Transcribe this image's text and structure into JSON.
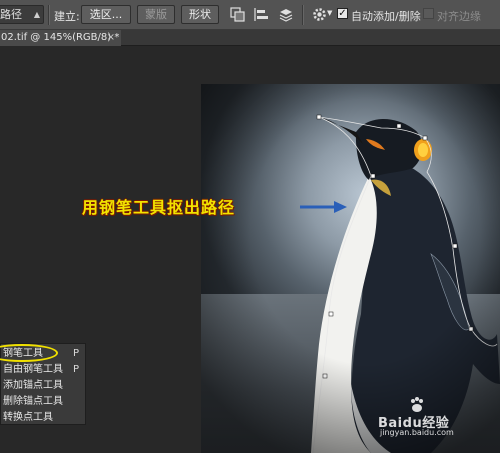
{
  "toolbar": {
    "mode_value": "路径",
    "make_label": "建立:",
    "selection_label": "选区...",
    "mask_label": "蒙版",
    "shape_label": "形状",
    "auto_add_delete_label": "自动添加/删除",
    "auto_add_delete_checked": true,
    "align_edges_label": "对齐边缘",
    "align_edges_checked": false
  },
  "document_tab": {
    "title": "02.tif @ 145%(RGB/8) *",
    "close_symbol": "×"
  },
  "annotation": {
    "text": "用钢笔工具抠出路径"
  },
  "tool_flyout": {
    "items": [
      {
        "label": "钢笔工具",
        "shortcut": "P"
      },
      {
        "label": "自由钢笔工具",
        "shortcut": "P"
      },
      {
        "label": "添加锚点工具",
        "shortcut": ""
      },
      {
        "label": "删除锚点工具",
        "shortcut": ""
      },
      {
        "label": "转换点工具",
        "shortcut": ""
      }
    ]
  },
  "watermark": {
    "brand": "Baidu经验",
    "url": "jingyan.baidu.com"
  },
  "colors": {
    "annotation_text": "#f2e300",
    "highlight_oval": "#f0e000",
    "arrow": "#2a5fb8"
  }
}
